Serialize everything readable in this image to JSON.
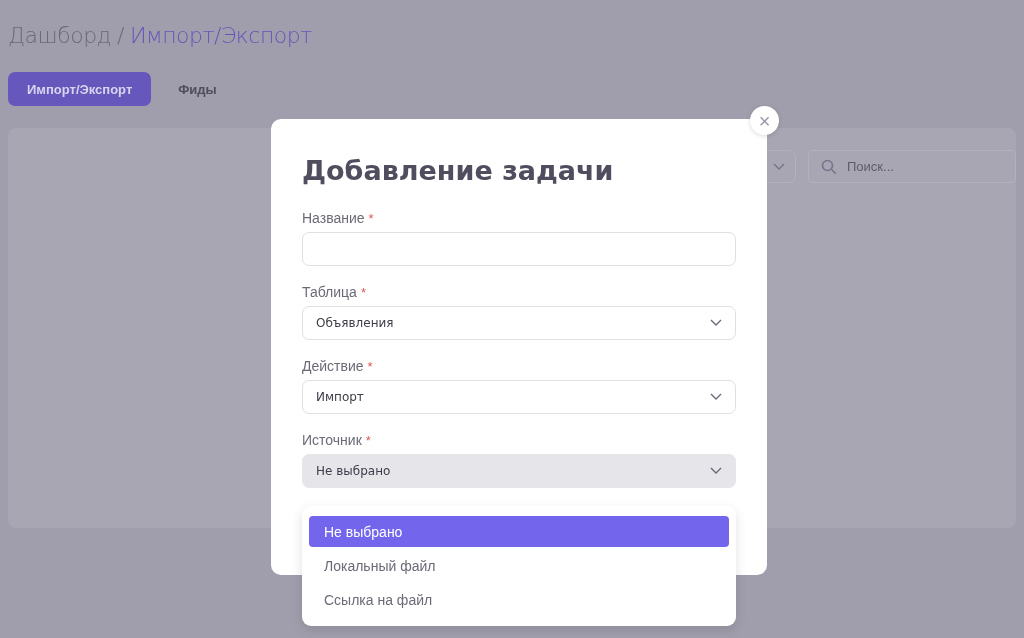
{
  "breadcrumb": {
    "root": "Дашборд",
    "separator": "/",
    "current": "Импорт/Экспорт"
  },
  "tabs": [
    {
      "label": "Импорт/Экспорт",
      "selected": true
    },
    {
      "label": "Фиды",
      "selected": false
    }
  ],
  "search": {
    "placeholder": "Поиск..."
  },
  "modal": {
    "title": "Добавление задачи",
    "close": "×",
    "fields": [
      {
        "kind": "input",
        "label": "Название",
        "required_mark": "*"
      },
      {
        "kind": "select",
        "label": "Таблица",
        "required_mark": "*",
        "value": "Объявления",
        "open": false
      },
      {
        "kind": "select",
        "label": "Действие",
        "required_mark": "*",
        "value": "Импорт",
        "open": false
      },
      {
        "kind": "select",
        "label": "Источник",
        "required_mark": "*",
        "value": "Не выбрано",
        "open": true,
        "options": [
          {
            "label": "Не выбрано",
            "selected": true
          },
          {
            "label": "Локальный файл",
            "selected": false
          },
          {
            "label": "Ссылка на файл",
            "selected": false
          }
        ]
      }
    ]
  }
}
